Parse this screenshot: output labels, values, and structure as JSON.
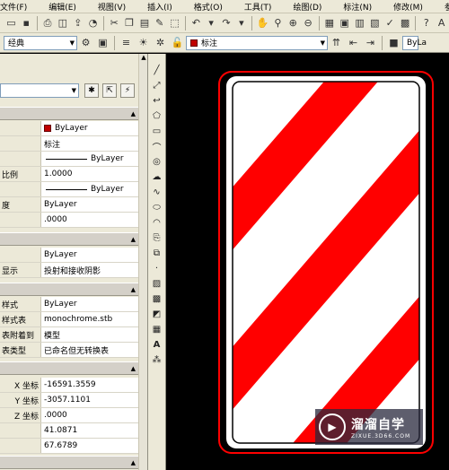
{
  "menu": {
    "items": [
      "文件(F)",
      "编辑(E)",
      "视图(V)",
      "插入(I)",
      "格式(O)",
      "工具(T)",
      "绘图(D)",
      "标注(N)",
      "修改(M)",
      "参数(P)"
    ]
  },
  "toolbar2": {
    "workspace_value": "经典",
    "layer_value": "标注",
    "right_value": "ByLa"
  },
  "sections": {
    "general": "",
    "3d_visual": "",
    "plot_style": "",
    "view": ""
  },
  "properties": {
    "general": [
      {
        "name": "",
        "value": "ByLayer",
        "kind": "color"
      },
      {
        "name": "",
        "value": "标注",
        "kind": "text"
      },
      {
        "name": "",
        "value": "ByLayer",
        "kind": "linetype"
      },
      {
        "name": "比例",
        "value": "1.0000",
        "kind": "text"
      },
      {
        "name": "",
        "value": "ByLayer",
        "kind": "linetype"
      },
      {
        "name": "度",
        "value": "ByLayer",
        "kind": "text"
      },
      {
        "name": "",
        "value": ".0000",
        "kind": "text"
      }
    ],
    "visual": [
      {
        "name": "",
        "value": "ByLayer"
      },
      {
        "name": "显示",
        "value": "投射和接收阴影"
      }
    ],
    "plot": [
      {
        "name": "样式",
        "value": "ByLayer"
      },
      {
        "name": "样式表",
        "value": "monochrome.stb"
      },
      {
        "name": "表附着到",
        "value": "模型"
      },
      {
        "name": "表类型",
        "value": "已命名但无转换表"
      }
    ],
    "view": [
      {
        "name": "X 坐标",
        "value": "-16591.3559"
      },
      {
        "name": "Y 坐标",
        "value": "-3057.1101"
      },
      {
        "name": "Z 坐标",
        "value": ".0000"
      },
      {
        "name": "",
        "value": "41.0871"
      },
      {
        "name": "",
        "value": "67.6789"
      }
    ]
  },
  "drawing": {
    "stripe_color": "#ff0000",
    "border_color": "#ff0000",
    "background_color": "#ffffff"
  },
  "watermark": {
    "title": "溜溜自学",
    "subtitle": "ZIXUE.3D66.COM"
  }
}
